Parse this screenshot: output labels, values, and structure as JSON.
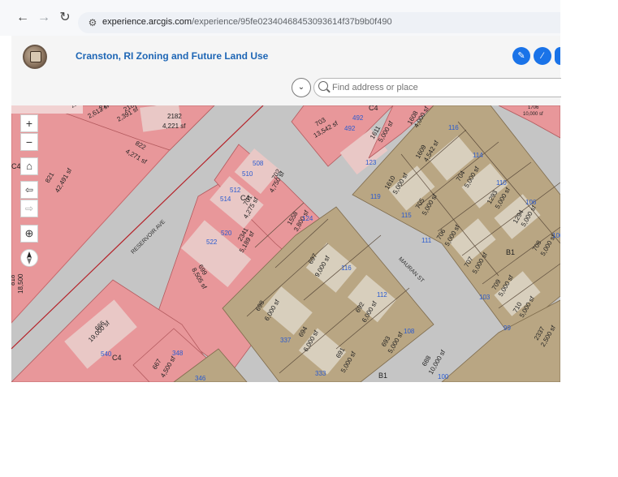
{
  "browser": {
    "url_host": "experience.arcgis.com",
    "url_path": "/experience/95fe02340468453093614f37b9b0f490",
    "back_icon": "arrow-left-icon",
    "forward_icon": "arrow-right-icon",
    "reload_icon": "reload-icon",
    "site_info_icon": "site-settings-icon"
  },
  "app": {
    "title": "Cranston, RI Zoning and Future Land Use",
    "logo_icon": "city-seal",
    "header_buttons": [
      "palette-icon",
      "measure-icon",
      "share-icon"
    ],
    "collapse_icon": "chevron-down-icon",
    "search": {
      "placeholder": "Find address or place",
      "value": ""
    },
    "accent_color": "#1a73e8",
    "title_color": "#1e66b5"
  },
  "map_controls": {
    "zoom_in": "+",
    "zoom_out": "−",
    "home_icon": "home-icon",
    "previous_extent_icon": "arrow-left-outline-icon",
    "next_extent_icon": "arrow-right-outline-icon",
    "locate_icon": "locate-crosshair-icon",
    "compass_icon": "compass-icon"
  },
  "map": {
    "colors": {
      "road": "#c8c8c8",
      "commercial_zone": "#e8979a",
      "residential_zone": "#b9a683",
      "building": "#e9c8c6",
      "building_residential": "#d8cfbd",
      "zone_line": "#b5232a"
    },
    "street_labels": [
      "RESERVOIR AVE",
      "MAURAN ST"
    ],
    "zone_labels": [
      "C4",
      "C4",
      "C4",
      "C4",
      "B1",
      "B1"
    ],
    "parcel_labels": [
      {
        "num": "2176",
        "area": "2,614 sf"
      },
      {
        "num": "2180",
        "area": "2,612 sf"
      },
      {
        "num": "2181",
        "area": "2,391 sf"
      },
      {
        "num": "2182",
        "area": "4,221 sf"
      },
      {
        "num": "822",
        "area": "4,271 sf"
      },
      {
        "num": "821",
        "area": "42,491 sf"
      },
      {
        "num": "703",
        "area": "13,542 sf"
      },
      {
        "num": "1611",
        "area": "5,000 sf"
      },
      {
        "num": "1608",
        "area": "4,000 sf"
      },
      {
        "num": "1609",
        "area": "4,542 sf"
      },
      {
        "num": "704",
        "area": "5,000 sf"
      },
      {
        "num": "1293",
        "area": "5,000 sf"
      },
      {
        "num": "1294",
        "area": "5,000 sf"
      },
      {
        "num": "1610",
        "area": "5,000 sf"
      },
      {
        "num": "705",
        "area": "5,000 sf"
      },
      {
        "num": "706",
        "area": "5,000 sf"
      },
      {
        "num": "707",
        "area": "5,000 sf"
      },
      {
        "num": "708",
        "area": "5,000 sf"
      },
      {
        "num": "702",
        "area": "4,750 sf"
      },
      {
        "num": "701",
        "area": "4,275 sf"
      },
      {
        "num": "2341",
        "area": "5,189 sf"
      },
      {
        "num": "1558",
        "area": "3,800 sf"
      },
      {
        "num": "699",
        "area": "8,505 sf"
      },
      {
        "num": "697",
        "area": "9,000 sf"
      },
      {
        "num": "698",
        "area": "6,000 sf"
      },
      {
        "num": "692",
        "area": "6,000 sf"
      },
      {
        "num": "694",
        "area": "6,000 sf"
      },
      {
        "num": "693",
        "area": "5,000 sf"
      },
      {
        "num": "691",
        "area": "5,000 sf"
      },
      {
        "num": "688",
        "area": "10,000 sf"
      },
      {
        "num": "709",
        "area": "5,000 sf"
      },
      {
        "num": "710",
        "area": "5,000 sf"
      },
      {
        "num": "2337",
        "area": "2,500 sf"
      },
      {
        "num": "666",
        "area": "19,000 sf"
      },
      {
        "num": "667",
        "area": "4,500 sf"
      },
      {
        "num": "818",
        "area": "18,500"
      },
      {
        "num": "1706",
        "area": "10,000 sf"
      }
    ],
    "address_numbers": [
      "492",
      "492",
      "116",
      "123",
      "114",
      "110",
      "106",
      "119",
      "115",
      "111",
      "100",
      "508",
      "510",
      "512",
      "514",
      "520",
      "522",
      "124",
      "116",
      "112",
      "108",
      "103",
      "99",
      "337",
      "333",
      "100",
      "540",
      "348",
      "346"
    ]
  }
}
